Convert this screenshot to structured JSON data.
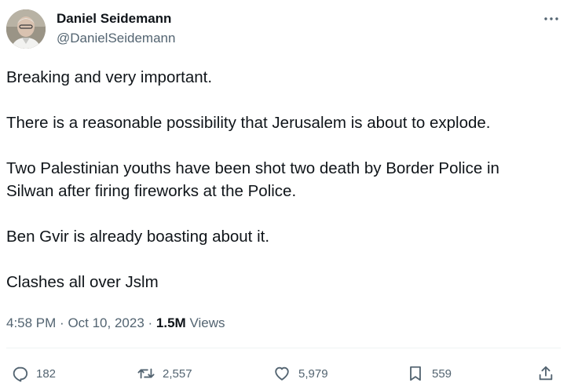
{
  "author": {
    "name": "Daniel Seidemann",
    "handle": "@DanielSeidemann"
  },
  "tweet": {
    "paragraphs": [
      "Breaking and very important.",
      "There is a reasonable possibility that Jerusalem is about to explode.",
      "Two Palestinian youths have been shot two death by Border Police in\nSilwan after firing fireworks at the Police.",
      "Ben Gvir is already boasting about it.",
      "Clashes all over Jslm"
    ],
    "time": "4:58 PM",
    "date": "Oct 10, 2023",
    "views_count": "1.5M",
    "views_label": "Views"
  },
  "actions": {
    "replies": "182",
    "reposts": "2,557",
    "likes": "5,979",
    "bookmarks": "559"
  },
  "icons": {
    "more": "more-horizontal-icon",
    "reply": "reply-icon",
    "repost": "repost-icon",
    "like": "heart-icon",
    "bookmark": "bookmark-icon",
    "share": "share-icon"
  }
}
